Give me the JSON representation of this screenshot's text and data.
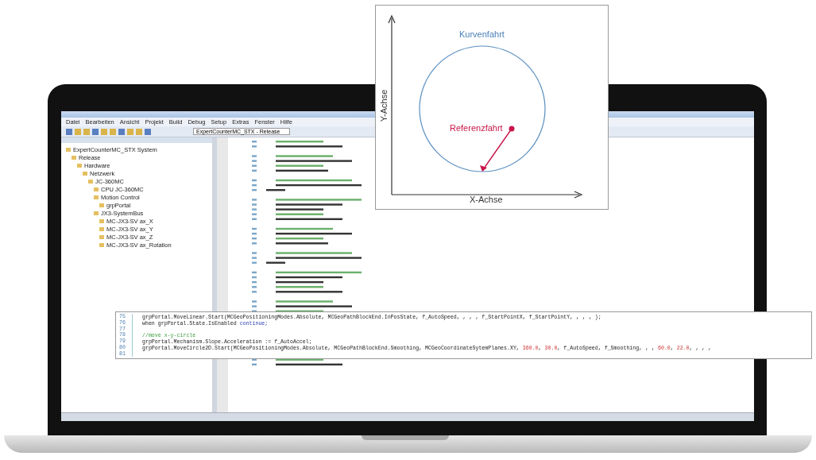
{
  "ide": {
    "menu": [
      "Datei",
      "Bearbeiten",
      "Ansicht",
      "Projekt",
      "Build",
      "Debug",
      "Setup",
      "Extras",
      "Fenster",
      "Hilfe"
    ],
    "toolbar_dropdown": "ExpertCounterMC_STX - Release",
    "tree": [
      {
        "label": "ExpertCounterMC_STX System",
        "children": [
          {
            "label": "Release",
            "children": [
              {
                "label": "Hardware",
                "children": [
                  {
                    "label": "Netzwerk",
                    "children": [
                      {
                        "label": "JC-360MC",
                        "children": [
                          {
                            "label": "CPU JC-360MC"
                          },
                          {
                            "label": "Motion Control",
                            "children": [
                              {
                                "label": "grpPortal"
                              }
                            ]
                          },
                          {
                            "label": "JX3-SystemBus",
                            "children": [
                              {
                                "label": "MC-JX3-SV ax_X"
                              },
                              {
                                "label": "MC-JX3-SV ax_Y"
                              },
                              {
                                "label": "MC-JX3-SV ax_Z"
                              },
                              {
                                "label": "MC-JX3-SV ax_Rotation"
                              }
                            ]
                          }
                        ]
                      }
                    ]
                  }
                ]
              }
            ]
          }
        ]
      }
    ]
  },
  "diagram": {
    "title": "Kurvenfahrt",
    "reference_label": "Referenzfahrt",
    "x_axis": "X-Achse",
    "y_axis": "Y-Achse"
  },
  "code_callout": {
    "lines": [
      {
        "number": "75",
        "parts": [
          {
            "kind": "code",
            "text": "grpPortal.MoveLinear.Start(MCGeoPositioningModes.Absolute, MCGeoPathBlockEnd.InPosState, f_AutoSpeed, , , , f_StartPointX, f_StartPointY, , , , );"
          }
        ]
      },
      {
        "number": "76",
        "parts": [
          {
            "kind": "code",
            "text": "when grpPortal.State.IsEnabled "
          },
          {
            "kind": "keyword",
            "text": "continue;"
          }
        ]
      },
      {
        "number": "77"
      },
      {
        "number": "78",
        "parts": [
          {
            "kind": "comment",
            "text": "//move x-y-circle"
          }
        ]
      },
      {
        "number": "79",
        "parts": [
          {
            "kind": "code",
            "text": "grpPortal.Mechanism.Slope.Acceleration := f_AutoAccel;"
          }
        ]
      },
      {
        "number": "80",
        "parts": [
          {
            "kind": "code",
            "text": "grpPortal.MoveCircle2D.Start(MCGeoPositioningModes.Absolute, MCGeoPathBlockEnd.Smoothing, MCGeoCoordinateSytemPlanes.XY, "
          },
          {
            "kind": "number",
            "text": "360.0"
          },
          {
            "kind": "code",
            "text": ", "
          },
          {
            "kind": "number",
            "text": "30.0"
          },
          {
            "kind": "code",
            "text": ", f_AutoSpeed, f_Smoothing, , , "
          },
          {
            "kind": "number",
            "text": "60.0"
          },
          {
            "kind": "code",
            "text": ", "
          },
          {
            "kind": "number",
            "text": "22.0"
          },
          {
            "kind": "code",
            "text": ", , , ,"
          }
        ]
      },
      {
        "number": "81"
      }
    ]
  }
}
